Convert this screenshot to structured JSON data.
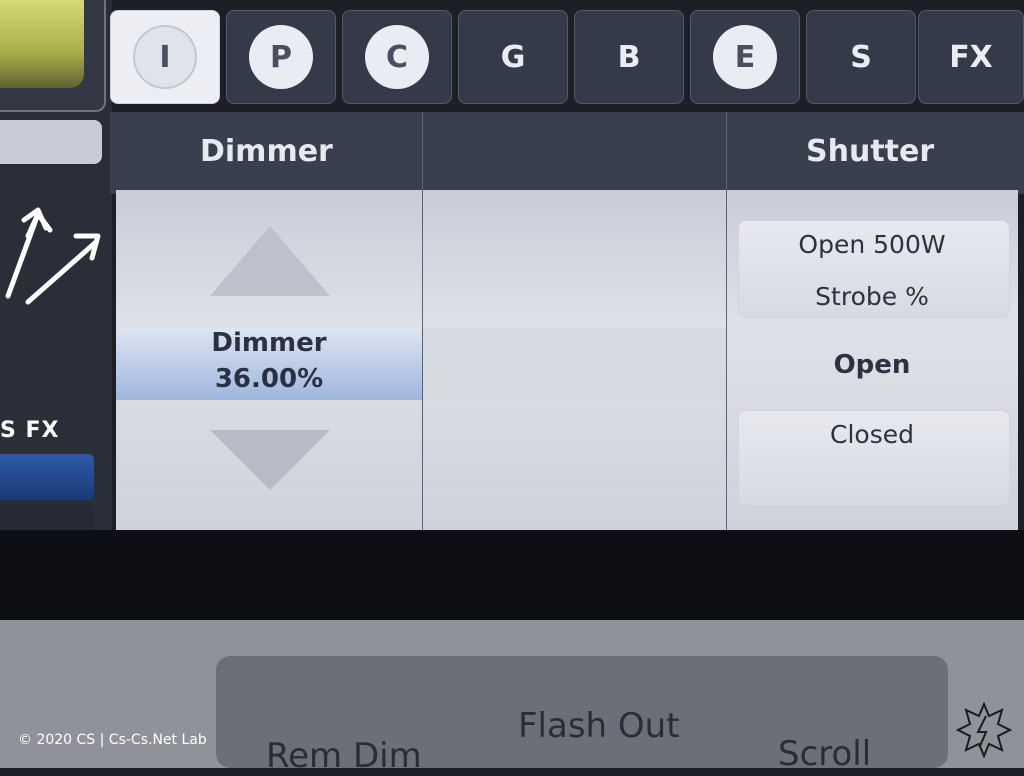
{
  "tabs": [
    {
      "letter": "I",
      "active": true,
      "circle": true
    },
    {
      "letter": "P",
      "active": false,
      "circle": true
    },
    {
      "letter": "C",
      "active": false,
      "circle": true
    },
    {
      "letter": "G",
      "active": false,
      "circle": false
    },
    {
      "letter": "B",
      "active": false,
      "circle": false
    },
    {
      "letter": "E",
      "active": false,
      "circle": true
    },
    {
      "letter": "S",
      "active": false,
      "circle": false
    },
    {
      "letter": "FX",
      "active": false,
      "circle": false
    }
  ],
  "sidebar": {
    "fx_label": "S FX",
    "move_icon": "move-arrows-icon"
  },
  "columns": {
    "dimmer": {
      "header": "Dimmer",
      "param_name": "Dimmer",
      "param_value": "36.00%"
    },
    "shutter": {
      "header": "Shutter",
      "options_above": [
        "Open 500W",
        "Strobe %"
      ],
      "selected": "Open",
      "options_below": [
        "Closed"
      ]
    }
  },
  "bottom_buttons": {
    "left": "Rem Dim",
    "center": "Flash Out",
    "right": "Scroll"
  },
  "footer": {
    "copyright": "© 2020 CS | Cs-Cs.Net Lab"
  },
  "colors": {
    "tab_bg": "#353a49",
    "active_tab_bg": "#eceef3",
    "panel_bg": "#dfe1e8",
    "selected_band": "#b8c9e6",
    "fx_bar": "#2f5aa6"
  }
}
